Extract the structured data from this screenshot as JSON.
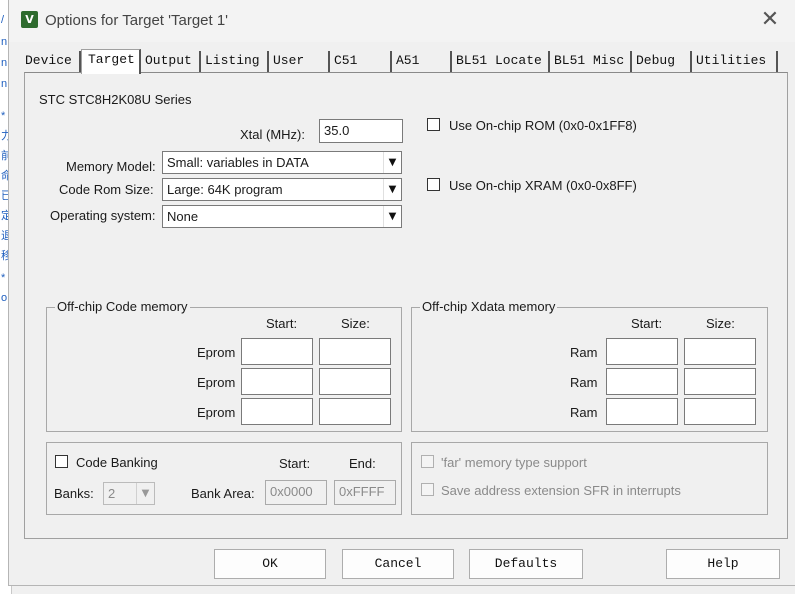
{
  "background_editor_fragments": [
    "/",
    "n",
    "n",
    "n",
    "*",
    "力",
    "前",
    "命",
    "已",
    "定",
    "退",
    "移",
    "*",
    "o"
  ],
  "window": {
    "title": "Options for Target 'Target 1'",
    "app_icon_glyph": "V",
    "close_glyph": "✕"
  },
  "tabs": [
    {
      "label": "Device",
      "active": false
    },
    {
      "label": "Target",
      "active": true
    },
    {
      "label": "Output",
      "active": false
    },
    {
      "label": "Listing",
      "active": false
    },
    {
      "label": "User",
      "active": false
    },
    {
      "label": "C51",
      "active": false
    },
    {
      "label": "A51",
      "active": false
    },
    {
      "label": "BL51 Locate",
      "active": false
    },
    {
      "label": "BL51 Misc",
      "active": false
    },
    {
      "label": "Debug",
      "active": false
    },
    {
      "label": "Utilities",
      "active": false
    }
  ],
  "target": {
    "device_series": "STC STC8H2K08U Series",
    "xtal": {
      "label": "Xtal (MHz):",
      "value": "35.0"
    },
    "memory_model": {
      "label": "Memory Model:",
      "value": "Small: variables in DATA"
    },
    "code_rom_size": {
      "label": "Code Rom Size:",
      "value": "Large: 64K program"
    },
    "operating_system": {
      "label": "Operating system:",
      "value": "None"
    },
    "use_onchip_rom": {
      "label": "Use On-chip ROM (0x0-0x1FF8)",
      "checked": false
    },
    "use_onchip_xram": {
      "label": "Use On-chip XRAM (0x0-0x8FF)",
      "checked": false
    }
  },
  "offchip_code": {
    "title": "Off-chip Code memory",
    "start_header": "Start:",
    "size_header": "Size:",
    "rows": [
      {
        "label": "Eprom",
        "start": "",
        "size": ""
      },
      {
        "label": "Eprom",
        "start": "",
        "size": ""
      },
      {
        "label": "Eprom",
        "start": "",
        "size": ""
      }
    ]
  },
  "offchip_xdata": {
    "title": "Off-chip Xdata memory",
    "start_header": "Start:",
    "size_header": "Size:",
    "rows": [
      {
        "label": "Ram",
        "start": "",
        "size": ""
      },
      {
        "label": "Ram",
        "start": "",
        "size": ""
      },
      {
        "label": "Ram",
        "start": "",
        "size": ""
      }
    ]
  },
  "banking": {
    "code_banking_label": "Code Banking",
    "code_banking_checked": false,
    "start_header": "Start:",
    "end_header": "End:",
    "banks_label": "Banks:",
    "banks_value": "2",
    "bank_area_label": "Bank Area:",
    "bank_area_start": "0x0000",
    "bank_area_end": "0xFFFF"
  },
  "options": {
    "far_memory_label": "'far' memory type support",
    "save_address_label": "Save address extension SFR in interrupts"
  },
  "buttons": {
    "ok": "OK",
    "cancel": "Cancel",
    "defaults": "Defaults",
    "help": "Help"
  },
  "colors": {
    "dialog_bg": "#f0f0f0",
    "tab_active_bg": "#ffffff",
    "disabled_text": "#8a8a8a",
    "app_icon_bg": "#2e6b2e"
  }
}
